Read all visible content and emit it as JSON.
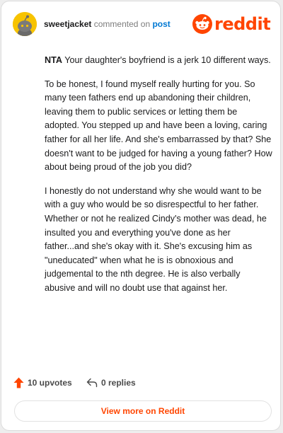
{
  "header": {
    "username": "sweetjacket",
    "action_text": "commented on",
    "target_link": "post",
    "brand": "reddit"
  },
  "comment": {
    "verdict": "NTA",
    "paragraphs": [
      " Your daughter's boyfriend is a jerk 10 different ways.",
      "To be honest, I found myself really hurting for you. So many teen fathers end up abandoning their children, leaving them to public services or letting them be adopted. You stepped up and have been a loving, caring father for all her life. And she's embarrassed by that? She doesn't want to be judged for having a young father? How about being proud of the job you did?",
      "I honestly do not understand why she would want to be with a guy who would be so disrespectful to her father. Whether or not he realized Cindy's mother was dead, he insulted you and everything you've done as her father...and she's okay with it. She's excusing him as \"uneducated\" when what he is is obnoxious and judgemental to the nth degree. He is also verbally abusive and will no doubt use that against her."
    ]
  },
  "footer": {
    "upvotes": "10 upvotes",
    "replies": "0 replies"
  },
  "view_more": "View more on Reddit",
  "colors": {
    "brand": "#ff4500",
    "link": "#0079d3",
    "avatar": "#f7c300"
  }
}
